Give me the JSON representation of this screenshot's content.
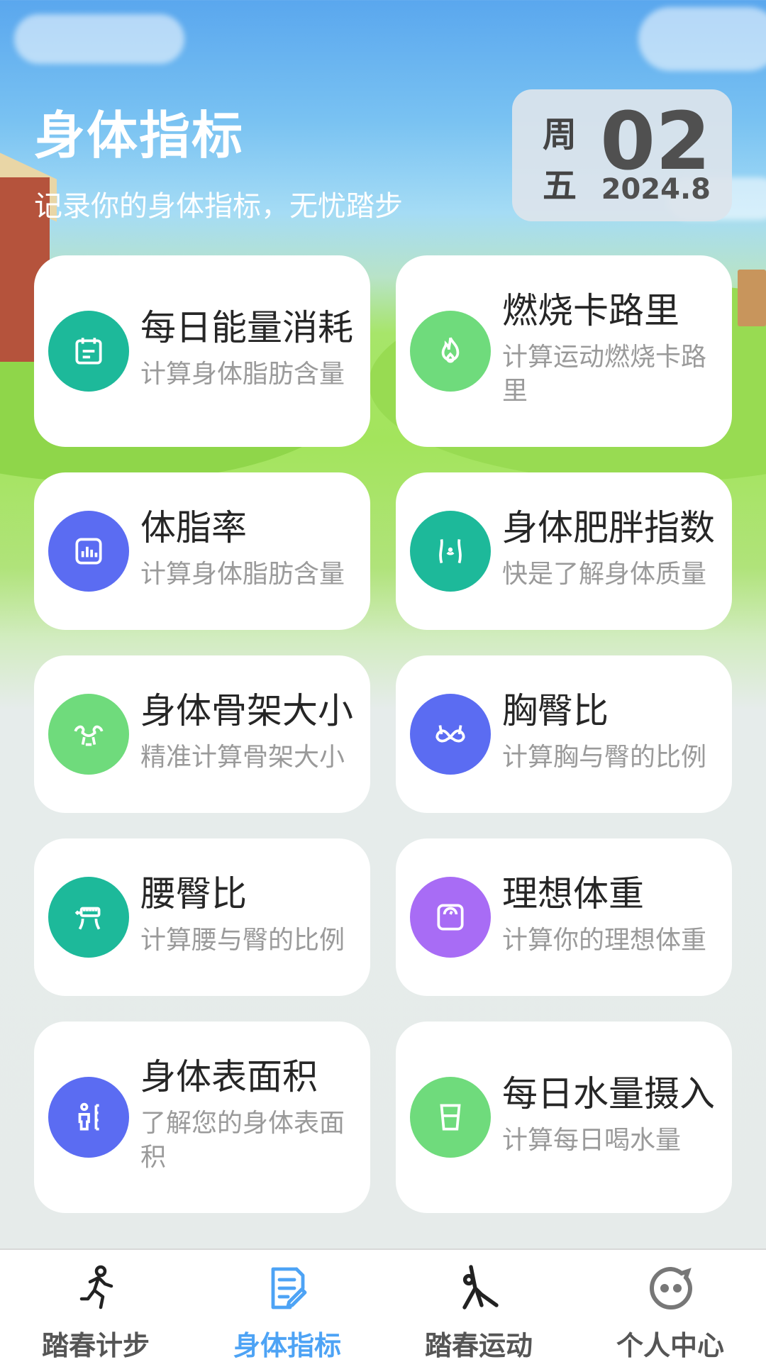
{
  "header": {
    "title": "身体指标",
    "subtitle": "记录你的身体指标，无忧踏步"
  },
  "date": {
    "weekday": "周五",
    "day": "02",
    "year_month": "2024.8"
  },
  "cards": [
    {
      "title": "每日能量消耗",
      "desc": "计算身体脂肪含量",
      "icon": "calendar-icon",
      "color": "#1db99a"
    },
    {
      "title": "燃烧卡路里",
      "desc": "计算运动燃烧卡路里",
      "icon": "flame-icon",
      "color": "#6fdb7c"
    },
    {
      "title": "体脂率",
      "desc": "计算身体脂肪含量",
      "icon": "bar-chart-icon",
      "color": "#5b6cf2"
    },
    {
      "title": "身体肥胖指数",
      "desc": "快是了解身体质量",
      "icon": "waist-icon",
      "color": "#1db99a"
    },
    {
      "title": "身体骨架大小",
      "desc": "精准计算骨架大小",
      "icon": "muscle-icon",
      "color": "#6fdb7c"
    },
    {
      "title": "胸臀比",
      "desc": "计算胸与臀的比例",
      "icon": "bra-icon",
      "color": "#5b6cf2"
    },
    {
      "title": "腰臀比",
      "desc": "计算腰与臀的比例",
      "icon": "tape-measure-icon",
      "color": "#1db99a"
    },
    {
      "title": "理想体重",
      "desc": "计算你的理想体重",
      "icon": "scale-icon",
      "color": "#a86cf5"
    },
    {
      "title": "身体表面积",
      "desc": "了解您的身体表面积",
      "icon": "body-height-icon",
      "color": "#5b6cf2"
    },
    {
      "title": "每日水量摄入",
      "desc": "计算每日喝水量",
      "icon": "water-cup-icon",
      "color": "#6fdb7c"
    }
  ],
  "tabs": [
    {
      "label": "踏春计步",
      "icon": "running-icon",
      "active": false
    },
    {
      "label": "身体指标",
      "icon": "document-edit-icon",
      "active": true
    },
    {
      "label": "踏春运动",
      "icon": "yoga-icon",
      "active": false
    },
    {
      "label": "个人中心",
      "icon": "smiley-icon",
      "active": false
    }
  ],
  "colors": {
    "active_tab": "#4da3f5",
    "inactive_tab": "#555555"
  }
}
